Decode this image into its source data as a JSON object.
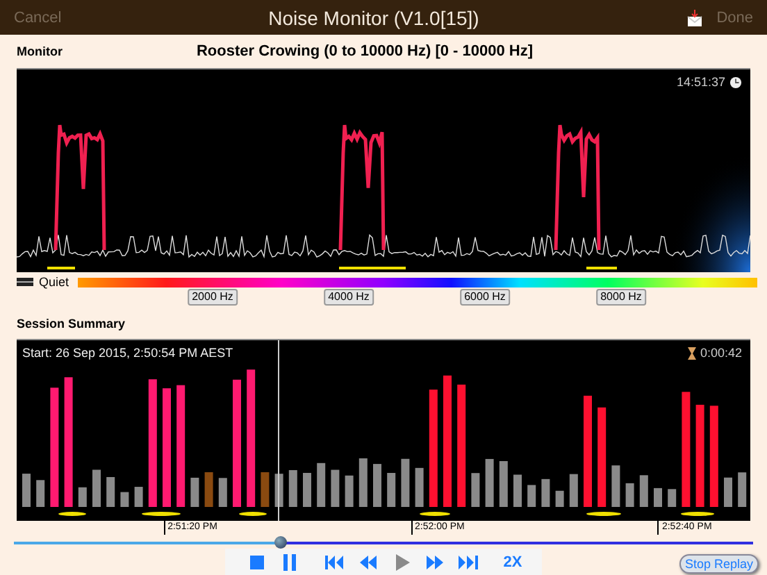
{
  "nav": {
    "cancel": {
      "label": "Cancel",
      "disabled": true
    },
    "title": "Noise Monitor (V1.0[15])",
    "done": {
      "label": "Done",
      "disabled": true
    }
  },
  "monitor": {
    "label": "Monitor",
    "heading": "Rooster Crowing (0 to 10000 Hz) [0 - 10000 Hz]",
    "clock": "14:51:37",
    "legend": "Quiet",
    "freq_labels": [
      "2000 Hz",
      "4000 Hz",
      "6000 Hz",
      "8000 Hz"
    ]
  },
  "summary": {
    "label": "Session Summary",
    "start": "Start: 26 Sep 2015, 2:50:54 PM AEST",
    "elapsed": "0:00:42",
    "time_labels": [
      "2:51:20 PM",
      "2:52:00 PM",
      "2:52:40 PM"
    ]
  },
  "playback": {
    "level": 0.36,
    "buttons": [
      {
        "kind": "stop",
        "disabled": false
      },
      {
        "kind": "pause",
        "disabled": false
      },
      {
        "kind": "skip-back",
        "disabled": false
      },
      {
        "kind": "rewind",
        "disabled": false
      },
      {
        "kind": "play",
        "disabled": true
      },
      {
        "kind": "forward",
        "disabled": false
      },
      {
        "kind": "skip-forward",
        "disabled": false
      }
    ],
    "speed": "2X",
    "stop_replay": "Stop Replay"
  }
}
